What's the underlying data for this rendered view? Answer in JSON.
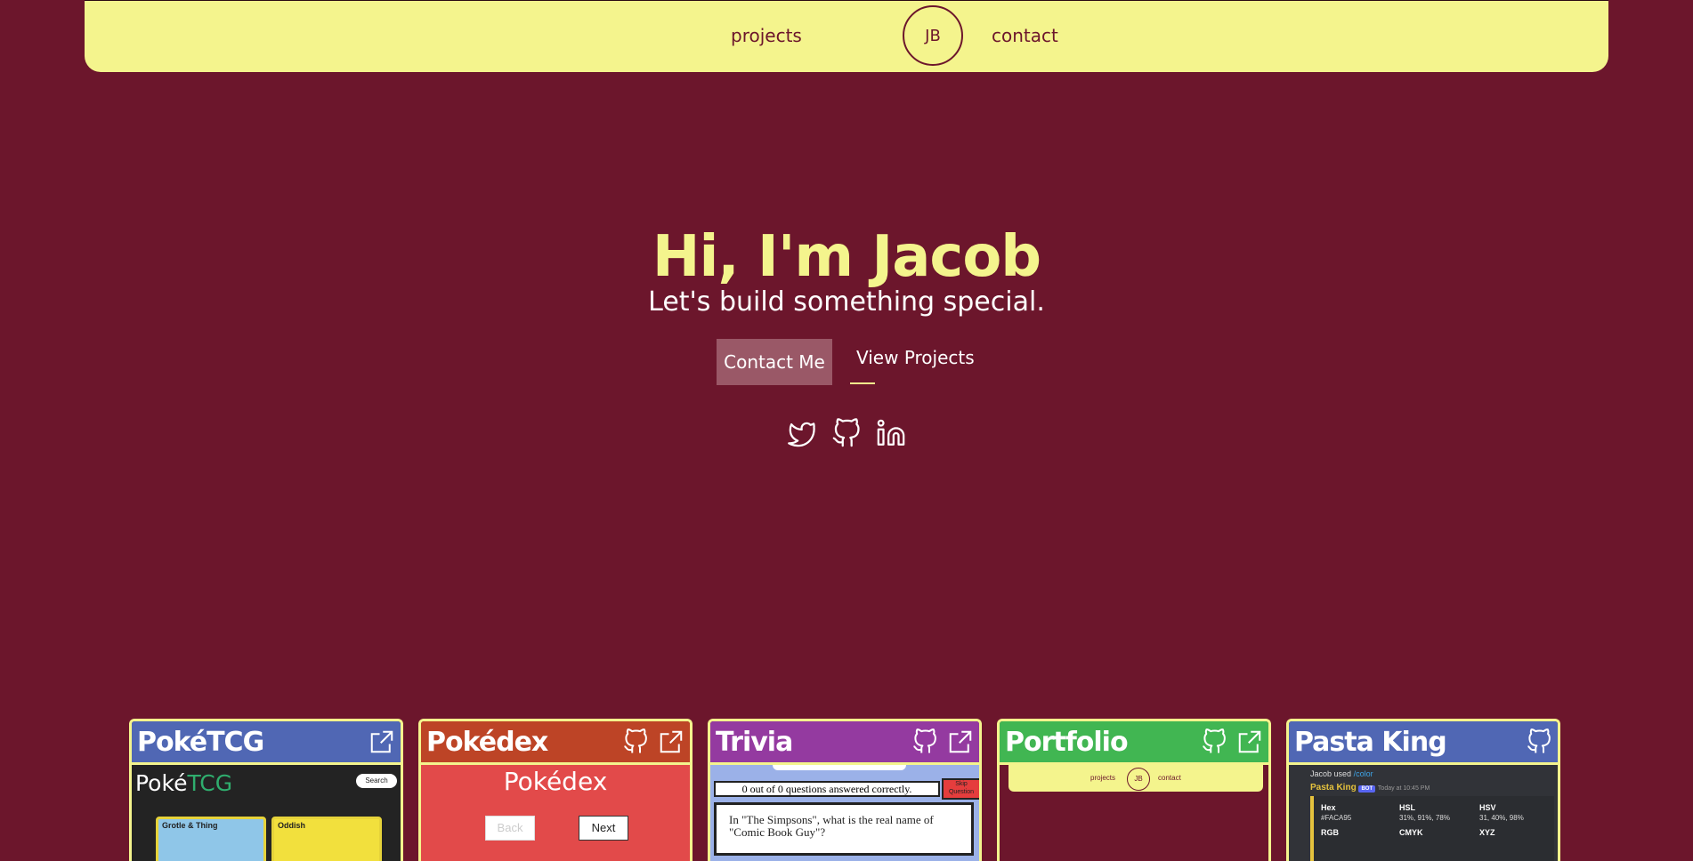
{
  "colors": {
    "background": "#6c162c",
    "accent": "#f4f48d",
    "button_bg": "#9a5867"
  },
  "nav": {
    "left_link": "projects",
    "logo": "JB",
    "right_link": "contact"
  },
  "hero": {
    "title": "Hi, I'm Jacob",
    "subtitle": "Let's build something special.",
    "contact_button": "Contact Me",
    "projects_button": "View Projects"
  },
  "social": [
    "twitter-icon",
    "github-icon",
    "linkedin-icon"
  ],
  "projects": [
    {
      "title": "PokéTCG",
      "color": "#5067b4",
      "icons": [
        "external-link-icon"
      ],
      "preview": {
        "logo_a": "Poké",
        "logo_b": "TCG",
        "search": "Search",
        "card_1": "Grotle & Thing",
        "card_2": "Oddish"
      }
    },
    {
      "title": "Pokédex",
      "color": "#bd4426",
      "icons": [
        "github-icon",
        "external-link-icon"
      ],
      "preview": {
        "heading": "Pokédex",
        "back": "Back",
        "next": "Next"
      }
    },
    {
      "title": "Trivia",
      "color": "#943aa0",
      "icons": [
        "github-icon",
        "external-link-icon"
      ],
      "preview": {
        "score": "0 out of 0 questions answered correctly.",
        "skip": "Skip Question",
        "question": "In \"The Simpsons\", what is the real name of \"Comic Book Guy\"?"
      }
    },
    {
      "title": "Portfolio",
      "color": "#41b652",
      "icons": [
        "github-icon",
        "external-link-icon"
      ],
      "preview": {
        "left": "projects",
        "logo": "JB",
        "right": "contact"
      }
    },
    {
      "title": "Pasta King",
      "color": "#5067b4",
      "icons": [
        "github-icon"
      ],
      "preview": {
        "user": "Jacob used",
        "cmd": "/color",
        "bot": "Pasta King",
        "bot_tag": "BOT",
        "time": "Today at 10:45 PM",
        "hex_k": "Hex",
        "hex_v": "#FACA95",
        "hsl_k": "HSL",
        "hsl_v": "31%, 91%, 78%",
        "hsv_k": "HSV",
        "hsv_v": "31, 40%, 98%",
        "rgb_k": "RGB",
        "cmyk_k": "CMYK",
        "xyz_k": "XYZ"
      }
    }
  ]
}
